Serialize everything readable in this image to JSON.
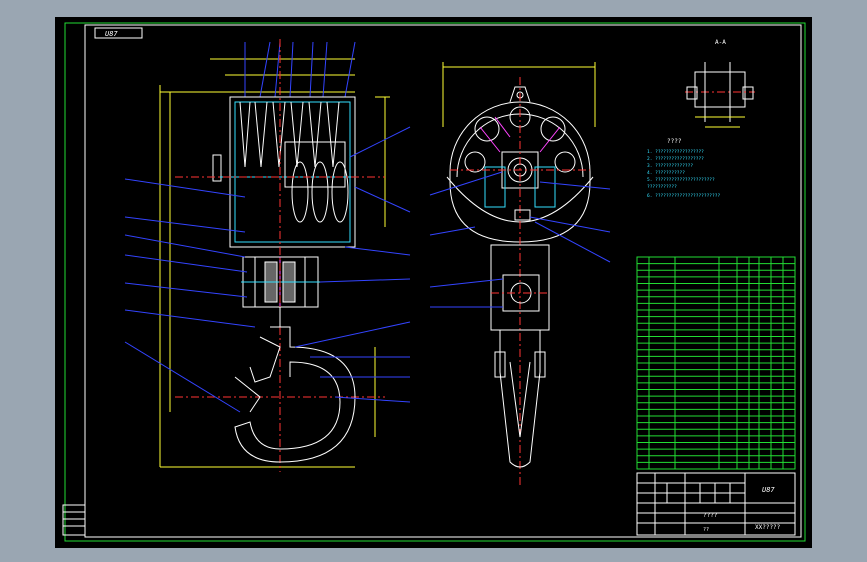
{
  "drawing": {
    "corner_tag": "U87",
    "scale_tag": "A-A",
    "notes_title": "????",
    "notes": [
      "1. ??????????????????",
      "2. ??????????????????",
      "3. ??????????????",
      "4. ???????????",
      "5. ??????????????????????",
      "   ???????????",
      "6. ????????????????????????"
    ],
    "title_block": {
      "drawing_no": "U87",
      "name": "????",
      "company": "XX?????",
      "qty_label": "??"
    }
  },
  "colors": {
    "background": "#000000",
    "outline": "#ffffff",
    "dimension": "#ffff33",
    "hidden": "#33e0ff",
    "leader": "#3344ff",
    "center": "#ff3333",
    "table": "#22dd33"
  }
}
